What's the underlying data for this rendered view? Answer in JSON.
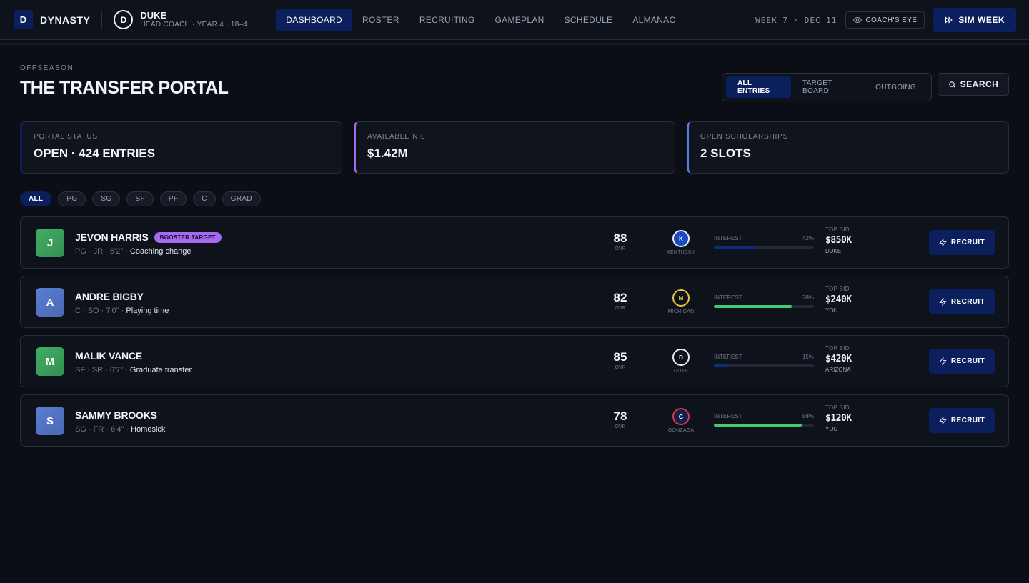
{
  "brand": {
    "badge": "D",
    "name": "DYNASTY"
  },
  "team": {
    "logo": "D",
    "name": "DUKE",
    "subtitle": "HEAD COACH · YEAR 4 · 18–4"
  },
  "nav": {
    "items": [
      {
        "label": "DASHBOARD",
        "active": true
      },
      {
        "label": "ROSTER",
        "active": false
      },
      {
        "label": "RECRUITING",
        "active": false
      },
      {
        "label": "GAMEPLAN",
        "active": false
      },
      {
        "label": "SCHEDULE",
        "active": false
      },
      {
        "label": "ALMANAC",
        "active": false
      }
    ]
  },
  "topbar": {
    "week": "WEEK 7 · DEC 11",
    "coach_eye_label": "COACH'S EYE",
    "sim_week_label": "SIM WEEK"
  },
  "header": {
    "eyebrow": "OFFSEASON",
    "title": "THE TRANSFER PORTAL",
    "tabs": [
      {
        "label": "ALL ENTRIES",
        "active": true
      },
      {
        "label": "TARGET BOARD",
        "active": false
      },
      {
        "label": "OUTGOING",
        "active": false
      }
    ],
    "search_label": "SEARCH"
  },
  "stats": [
    {
      "label": "PORTAL STATUS",
      "value": "OPEN · 424 ENTRIES",
      "accent": "#0a1f5c"
    },
    {
      "label": "AVAILABLE NIL",
      "value": "$1.42M",
      "accent": "#a66af0"
    },
    {
      "label": "OPEN SCHOLARSHIPS",
      "value": "2 SLOTS",
      "accent": "#5b7de0"
    }
  ],
  "filters": [
    {
      "label": "ALL",
      "active": true
    },
    {
      "label": "PG",
      "active": false
    },
    {
      "label": "SG",
      "active": false
    },
    {
      "label": "SF",
      "active": false
    },
    {
      "label": "PF",
      "active": false
    },
    {
      "label": "C",
      "active": false
    },
    {
      "label": "GRAD",
      "active": false
    }
  ],
  "players": [
    {
      "initial": "J",
      "name": "JEVON HARRIS",
      "badge": "BOOSTER TARGET",
      "meta": "PG · JR · 6'2\" · ",
      "reason": "Coaching change",
      "ovr": "88",
      "ovr_label": "OVR",
      "school_logo": "K",
      "school": "KENTUCKY",
      "school_color": "#1a49c4",
      "school_ring": "#e9edf5",
      "interest_label": "INTEREST",
      "interest_pct": "42%",
      "interest_value": 0.42,
      "interest_color": "#0f2c80",
      "bid_label": "TOP BID",
      "bid": "$850K",
      "bid_by": "DUKE",
      "avatar_color": "#3fae62",
      "recruit_label": "RECRUIT"
    },
    {
      "initial": "A",
      "name": "ANDRE BIGBY",
      "badge": "",
      "meta": "C · SO · 7'0\" · ",
      "reason": "Playing time",
      "ovr": "82",
      "ovr_label": "OVR",
      "school_logo": "M",
      "school": "MICHIGAN",
      "school_color": "#0e121a",
      "school_ring": "#e7c83a",
      "interest_label": "INTEREST",
      "interest_pct": "78%",
      "interest_value": 0.78,
      "interest_color": "#45c977",
      "bid_label": "TOP BID",
      "bid": "$240K",
      "bid_by": "YOU",
      "avatar_color": "#5a7ed6",
      "recruit_label": "RECRUIT"
    },
    {
      "initial": "M",
      "name": "MALIK VANCE",
      "badge": "",
      "meta": "SF · SR · 6'7\" · ",
      "reason": "Graduate transfer",
      "ovr": "85",
      "ovr_label": "OVR",
      "school_logo": "D",
      "school": "DUKE",
      "school_color": "#0e121a",
      "school_ring": "#e9edf5",
      "interest_label": "INTEREST",
      "interest_pct": "15%",
      "interest_value": 0.15,
      "interest_color": "#0f2c80",
      "bid_label": "TOP BID",
      "bid": "$420K",
      "bid_by": "ARIZONA",
      "avatar_color": "#3fae62",
      "recruit_label": "RECRUIT"
    },
    {
      "initial": "S",
      "name": "SAMMY BROOKS",
      "badge": "",
      "meta": "SG · FR · 6'4\" · ",
      "reason": "Homesick",
      "ovr": "78",
      "ovr_label": "OVR",
      "school_logo": "G",
      "school": "GONZAGA",
      "school_color": "#13204a",
      "school_ring": "#d33a4a",
      "interest_label": "INTEREST",
      "interest_pct": "88%",
      "interest_value": 0.88,
      "interest_color": "#45c977",
      "bid_label": "TOP BID",
      "bid": "$120K",
      "bid_by": "YOU",
      "avatar_color": "#5a7ed6",
      "recruit_label": "RECRUIT"
    }
  ],
  "icons": {
    "eye": "eye-icon",
    "sim": "fast-forward-icon",
    "search": "search-icon",
    "recruit": "lightning-icon"
  }
}
